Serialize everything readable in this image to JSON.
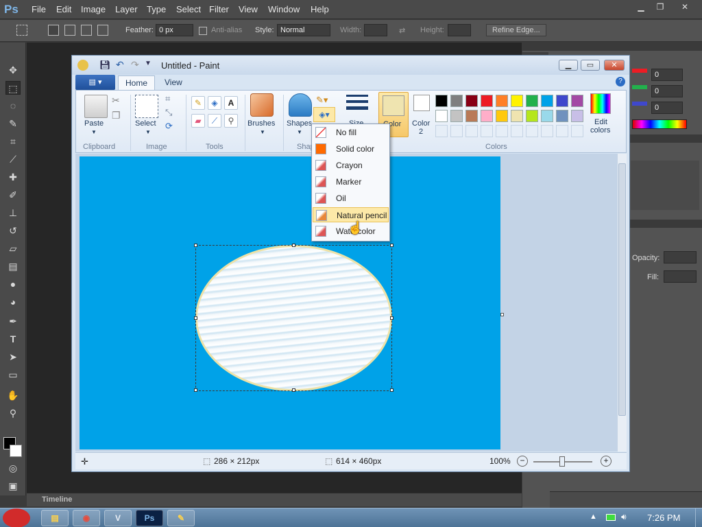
{
  "photoshop": {
    "logo": "Ps",
    "menu": [
      "File",
      "Edit",
      "Image",
      "Layer",
      "Type",
      "Select",
      "Filter",
      "View",
      "Window",
      "Help"
    ],
    "options": {
      "feather_label": "Feather:",
      "feather_value": "0 px",
      "antialias_label": "Anti-alias",
      "style_label": "Style:",
      "style_value": "Normal",
      "width_label": "Width:",
      "height_label": "Height:",
      "refine_edge": "Refine Edge..."
    },
    "right_panel": {
      "opacity_label": "Opacity:",
      "fill_label": "Fill:",
      "color_r": "0",
      "color_g": "0",
      "color_b": "0"
    },
    "timeline_label": "Timeline"
  },
  "paint": {
    "title": "Untitled - Paint",
    "tabs": [
      "Home",
      "View"
    ],
    "groups": {
      "clipboard": "Clipboard",
      "image": "Image",
      "tools": "Tools",
      "shapes": "Shap",
      "colors": "Colors"
    },
    "buttons": {
      "paste": "Paste",
      "select": "Select",
      "brushes": "Brushes",
      "shapes": "Shapes",
      "size": "Size",
      "color1": "Color",
      "color2": "Color",
      "color2_num": "2",
      "edit_colors_1": "Edit",
      "edit_colors_2": "colors"
    },
    "palette_row1": [
      "#000000",
      "#7f7f7f",
      "#880015",
      "#ed1c24",
      "#ff7f27",
      "#fff200",
      "#22b14c",
      "#00a2e8",
      "#3f48cc",
      "#a349a4"
    ],
    "palette_row2": [
      "#ffffff",
      "#c3c3c3",
      "#b97a57",
      "#ffaec9",
      "#ffc90e",
      "#efe4b0",
      "#b5e61d",
      "#99d9ea",
      "#7092be",
      "#c8bfe7"
    ],
    "status": {
      "selection_size": "286 × 212px",
      "image_size": "614 × 460px",
      "zoom": "100%"
    }
  },
  "fill_menu": {
    "items": [
      "No fill",
      "Solid color",
      "Crayon",
      "Marker",
      "Oil",
      "Natural pencil",
      "Watercolor"
    ],
    "highlighted": "Natural pencil"
  },
  "taskbar": {
    "clock": "7:26 PM",
    "apps": [
      "Explorer",
      "Chrome",
      "VLC",
      "Photoshop",
      "Paint"
    ]
  },
  "colors": {
    "canvas_blue": "#00a2e8",
    "color1_swatch": "#efe4b0"
  }
}
